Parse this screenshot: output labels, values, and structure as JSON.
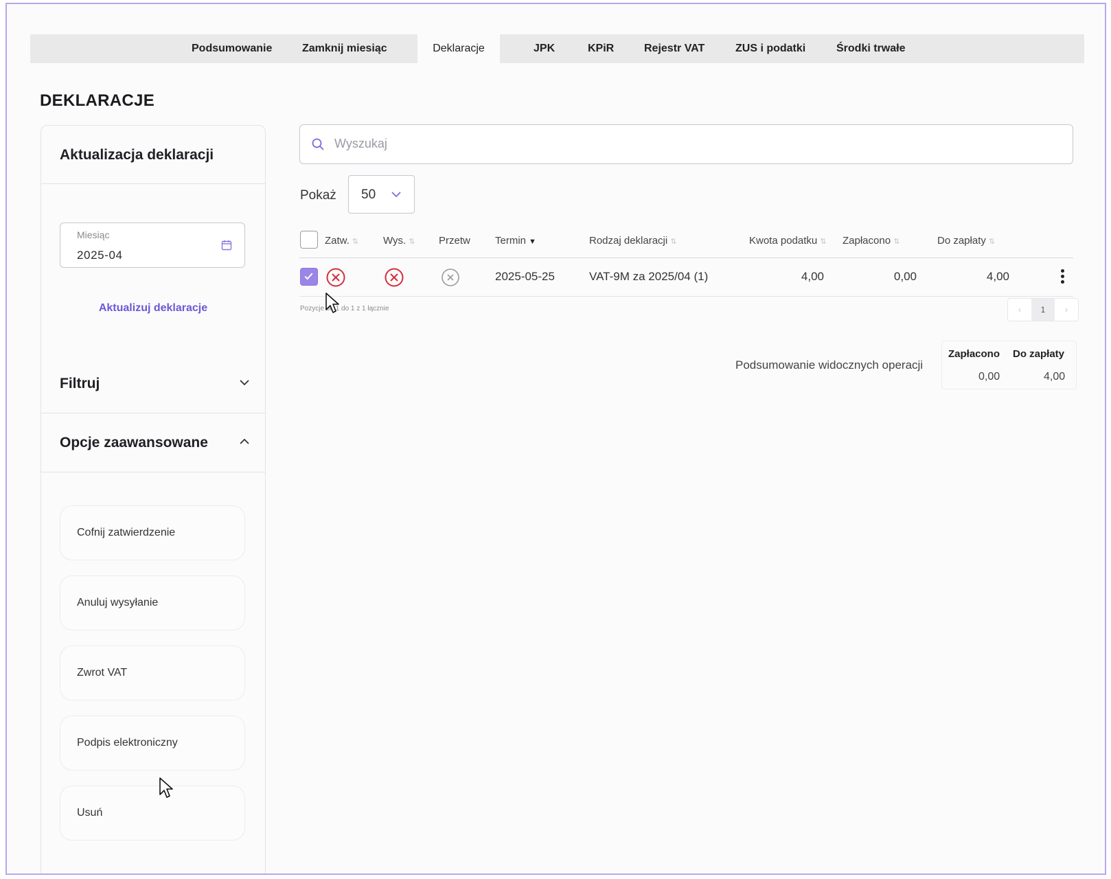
{
  "tabs": [
    "Podsumowanie",
    "Zamknij miesiąc",
    "Deklaracje",
    "JPK",
    "KPiR",
    "Rejestr VAT",
    "ZUS i podatki",
    "Środki trwałe"
  ],
  "page_title": "DEKLARACJE",
  "sidebar": {
    "update_title": "Aktualizacja deklaracji",
    "month_label": "Miesiąc",
    "month_value": "2025-04",
    "update_link": "Aktualizuj deklaracje",
    "filter_label": "Filtruj",
    "advanced_label": "Opcje zaawansowane",
    "advanced_buttons": [
      "Cofnij zatwierdzenie",
      "Anuluj wysyłanie",
      "Zwrot VAT",
      "Podpis elektroniczny",
      "Usuń"
    ]
  },
  "search": {
    "placeholder": "Wyszukaj"
  },
  "show": {
    "label": "Pokaż",
    "value": "50"
  },
  "table": {
    "headers": [
      "Zatw.",
      "Wys.",
      "Przetw",
      "Termin",
      "Rodzaj deklaracji",
      "Kwota podatku",
      "Zapłacono",
      "Do zapłaty"
    ],
    "rows": [
      {
        "checked": true,
        "zatw": "rejected",
        "wys": "rejected",
        "przetw": "none",
        "termin": "2025-05-25",
        "rodzaj": "VAT-9M za 2025/04 (1)",
        "kwota": "4,00",
        "zaplacono": "0,00",
        "do_zaplaty": "4,00"
      }
    ],
    "pager_info": "Pozycje od 1 do 1 z 1 łącznie",
    "pager_prev": "‹",
    "pager_page": "1",
    "pager_next": "›"
  },
  "summary": {
    "label": "Podsumowanie widocznych operacji",
    "col1": "Zapłacono",
    "col2": "Do zapłaty",
    "val1": "0,00",
    "val2": "4,00"
  },
  "colors": {
    "accent": "#6d58d6",
    "checked": "#9a86e6",
    "reject": "#d32f3c",
    "border": "#b8a6ee"
  }
}
